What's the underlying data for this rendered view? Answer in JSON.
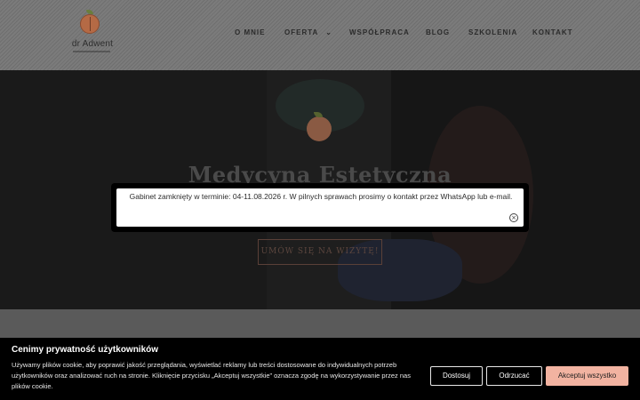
{
  "brand": {
    "logo_text": "dr Adwent"
  },
  "nav": {
    "items": [
      {
        "label": "O MNIE"
      },
      {
        "label": "OFERTA",
        "has_dropdown": true,
        "chevron": "⌄"
      },
      {
        "label": "WSPÓŁPRACA"
      },
      {
        "label": "BLOG"
      },
      {
        "label": "SZKOLENIA"
      },
      {
        "label": "KONTAKT"
      }
    ]
  },
  "hero": {
    "title": "Medycyna Estetyczna",
    "cta_label": "UMÓW SIĘ NA WIZYTĘ!"
  },
  "notice": {
    "text": "Gabinet zamknięty w terminie: 04-11.08.2026 r. W pilnych sprawach prosimy o kontakt przez WhatsApp lub e-mail.",
    "close_glyph": "×"
  },
  "cookie_bar": {
    "title": "Cenimy prywatność użytkowników",
    "text": "Używamy plików cookie, aby poprawić jakość przeglądania, wyświetlać reklamy lub treści dostosowane do indywidualnych potrzeb użytkowników oraz analizować ruch na stronie. Kliknięcie przycisku „Akceptuj wszystkie” oznacza zgodę na wykorzystywanie przez nas plików cookie.",
    "buttons": {
      "customize": "Dostosuj",
      "reject": "Odrzucać",
      "accept_all": "Akceptuj wszystko"
    }
  },
  "colors": {
    "accent": "#f2b3a1",
    "brand_fruit": "#b56a45",
    "overlay": "#000000"
  }
}
